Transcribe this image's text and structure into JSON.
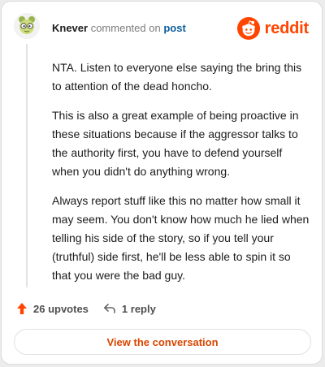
{
  "comment": {
    "author": "Knever",
    "action": "commented on",
    "target": "post",
    "paragraphs": [
      "NTA. Listen to everyone else saying the bring this to attention of the dead honcho.",
      "This is also a great example of being proactive in these situations because if the aggressor talks to the authority first, you have to defend yourself when you didn't do anything wrong.",
      "Always report stuff like this no matter how small it may seem. You don't know how much he lied when telling his side of the story, so if you tell your (truthful) side first, he'll be less able to spin it so that you were the bad guy."
    ]
  },
  "brand": {
    "name": "reddit",
    "icon": "reddit-logo-icon",
    "color": "#ff4500"
  },
  "actions": {
    "upvotes": "26 upvotes",
    "reply": "1 reply",
    "upvote_icon": "upvote-arrow-icon",
    "reply_icon": "reply-arrow-icon"
  },
  "cta": {
    "label": "View the conversation"
  },
  "colors": {
    "accent": "#ff4500",
    "link": "#0a5d9a",
    "text": "#1c1c1c"
  }
}
